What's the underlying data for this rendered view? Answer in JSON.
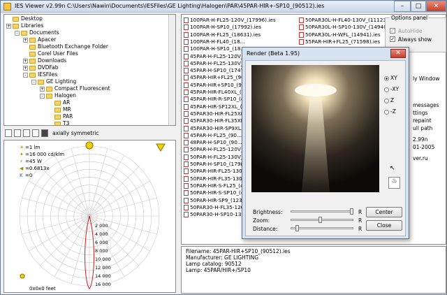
{
  "window": {
    "title": "IES Viewer v2.99n   C:\\Users\\Nawin\\Documents\\IESFiles\\GE Lighting\\Halogen\\PAR\\45PAR-HIR+-SP10_(90512).ies",
    "min": "–",
    "max": "□",
    "close": "✕"
  },
  "tree": {
    "items": [
      {
        "label": "Desktop",
        "depth": 0,
        "exp": ""
      },
      {
        "label": "Libraries",
        "depth": 0,
        "exp": "+"
      },
      {
        "label": "Documents",
        "depth": 1,
        "exp": "-"
      },
      {
        "label": "Apacer",
        "depth": 2,
        "exp": "+"
      },
      {
        "label": "Bluetooth Exchange Folder",
        "depth": 2,
        "exp": ""
      },
      {
        "label": "Corel User Files",
        "depth": 2,
        "exp": ""
      },
      {
        "label": "Downloads",
        "depth": 2,
        "exp": "+"
      },
      {
        "label": "DVDFab",
        "depth": 2,
        "exp": "+"
      },
      {
        "label": "IESFiles",
        "depth": 2,
        "exp": "-"
      },
      {
        "label": "GE Lighting",
        "depth": 3,
        "exp": "-"
      },
      {
        "label": "Compact Fluorescent",
        "depth": 4,
        "exp": "+"
      },
      {
        "label": "Halogen",
        "depth": 4,
        "exp": "-"
      },
      {
        "label": "AR",
        "depth": 5,
        "exp": ""
      },
      {
        "label": "MR",
        "depth": 5,
        "exp": ""
      },
      {
        "label": "PAR",
        "depth": 5,
        "exp": ""
      },
      {
        "label": "T3",
        "depth": 5,
        "exp": ""
      }
    ]
  },
  "toolbar": {
    "label": "axially symmetric"
  },
  "polar": {
    "info": [
      {
        "icon": "sun-icon",
        "text": "=1 lm"
      },
      {
        "icon": "bulb-icon",
        "text": "=16 000 cd/klm"
      },
      {
        "icon": "power-icon",
        "text": "=45 W"
      },
      {
        "icon": "cone-icon",
        "text": "=0.6813x"
      },
      {
        "icon": "k-icon",
        "text": "=0"
      }
    ],
    "scale": [
      "2 000",
      "4 000",
      "6 000",
      "8 000",
      "10 000",
      "12 000",
      "14 000",
      "16 000"
    ],
    "size": "0x0x0 feet"
  },
  "files": {
    "col1": [
      "100PAR-H-FL25-120V_(17996).ies",
      "100PAR-H-SP10_(17992).ies",
      "100PAR-H-FL25_(18631).ies",
      "100PAR-H-FL40_(18...",
      "100PAR-H-SP10_(18...",
      "45PAR-H-FL25-120V_...",
      "45PAR-H-FL25-130V_...",
      "45PAR-H-SP10_(17470...",
      "45PAR-HIR+FL25_(90...",
      "45PAR-HIR+SP10_(90...",
      "45PAR-HIR-FL40XL_(4...",
      "45PAR-HIR-R-SP10_(4...",
      "45PAR-HIR-SP12XL_(4...",
      "45PAR30-HIR-FL25XL...",
      "45PAR30-HIR-FL35XL...",
      "45PAR30-HIR-SP9XL...",
      "45PAR-H-FL25_(90...",
      "48PAR-H-SP10_(90...",
      "50PAR-H-FL25-120V_...",
      "50PAR-H-FL25-130V_...",
      "50PAR-H-SP10_(17980...",
      "50PAR-HIR-FL25-130V_...",
      "50PAR-HIR-FL35-130V_...",
      "50PAR-HIR-S-FL25_(46...",
      "50PAR-HIR-S-SP10_(46...",
      "50PAR-HIR-SP9_(1239...",
      "50PAR30-H-FL35-120V...",
      "50PAR30-H-SP10-130V..."
    ],
    "col2": [
      "50PAR30L-H-FL40-130V_(11123)",
      "50PAR30L-H-SP10-130V_(14940)",
      "50PAR30L-H-WFL_(14941).ies",
      "55PAR-HIR+FL25_(71598).ies"
    ]
  },
  "info": {
    "filename": "Filename: 45PAR-HIR+SP10_(90512).ies",
    "manufacturer": "Manufacturer: GE LIGHTING",
    "catalog": "Lamp catalog: 90512",
    "lamp": "Lamp: 45PAR/HIR+/SP10"
  },
  "options": {
    "legend": "Options panel",
    "autohide": "AutoHide",
    "always": "Always show"
  },
  "side": [
    "ly Window",
    "messages",
    "ttings",
    "repaint",
    "ull path",
    "2.99n",
    "01-2005",
    "ver.ru"
  ],
  "render": {
    "title": "Render (Beta 1.95)",
    "close": "✕",
    "views": [
      "XY",
      "-XY",
      "Z",
      "-Z"
    ],
    "brightness": "Brightness:",
    "zoom": "Zoom:",
    "distance": "Distance:",
    "r": "R",
    "center": "Center",
    "closebtn": "Close"
  }
}
